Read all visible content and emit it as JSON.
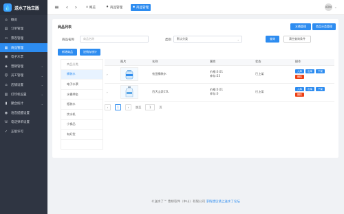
{
  "app": {
    "title": "送水了独立版"
  },
  "sidebar": {
    "items": [
      {
        "label": "概览",
        "icon": "home-icon",
        "caret": false
      },
      {
        "label": "订单管理",
        "icon": "order-icon",
        "caret": false
      },
      {
        "label": "票卷管理",
        "icon": "ticket-icon",
        "caret": false
      },
      {
        "label": "商品管理",
        "icon": "goods-icon",
        "caret": false,
        "active": true
      },
      {
        "label": "电子水票",
        "icon": "e-ticket-icon",
        "caret": false
      },
      {
        "label": "营销管理",
        "icon": "marketing-icon",
        "caret": true
      },
      {
        "label": "员工管理",
        "icon": "staff-icon",
        "caret": true
      },
      {
        "label": "店铺设置",
        "icon": "store-icon",
        "caret": true
      },
      {
        "label": "打印机设置",
        "icon": "printer-icon",
        "caret": true
      },
      {
        "label": "聚合统计",
        "icon": "stats-icon",
        "caret": true
      },
      {
        "label": "语音提醒设置",
        "icon": "voice-icon",
        "caret": false
      },
      {
        "label": "电话弹单设置",
        "icon": "phone-icon",
        "caret": false
      },
      {
        "label": "正版许可",
        "icon": "license-icon",
        "caret": false
      }
    ]
  },
  "topbar": {
    "breadcrumbs": [
      {
        "label": "概览",
        "icon": "home-icon"
      },
      {
        "label": "商品管理",
        "icon": "pin-icon"
      },
      {
        "label": "商品管理",
        "icon": "tag-icon"
      }
    ],
    "avatar_text": "ADM"
  },
  "main": {
    "title": "商品列表",
    "water_manage_btn": "水桶管理",
    "category_manage_btn": "商品分类管理",
    "filter": {
      "name_label": "商品名称",
      "name_placeholder": "商品名称",
      "category_label": "类别",
      "category_value": "默认分类",
      "search_btn": "查询",
      "clear_btn": "清空查询条件"
    },
    "add_goods_btn": "新增商品",
    "stock_btn": "进销存统计",
    "categories": [
      "商品分类",
      "桶装水",
      "电子水票",
      "水桶押金",
      "瓶装水",
      "饮水机",
      "小食品",
      "有好货"
    ],
    "table": {
      "headers": [
        "",
        "图片",
        "名称",
        "属性",
        "状态",
        "操作"
      ],
      "rows": [
        {
          "name": "农田桶装水",
          "price": "价格:0.01",
          "stock": "库存:53",
          "status": "已上架",
          "ops": [
            "入库",
            "出库",
            "下架",
            "删除"
          ]
        },
        {
          "name": "百大山泉15L",
          "price": "价格:0.01",
          "stock": "库存:0",
          "status": "已上架",
          "ops": [
            "入库",
            "出库",
            "下架",
            "删除"
          ]
        }
      ]
    },
    "pager": {
      "prev": "‹",
      "page": "1",
      "next": "›",
      "goto_label": "跳至",
      "goto_value": "1",
      "unit": "页"
    }
  },
  "footer": {
    "text": "©送水了™ 鲁桥软件（中山）有限公司 ",
    "link": "求购建议请上送水了论坛"
  }
}
